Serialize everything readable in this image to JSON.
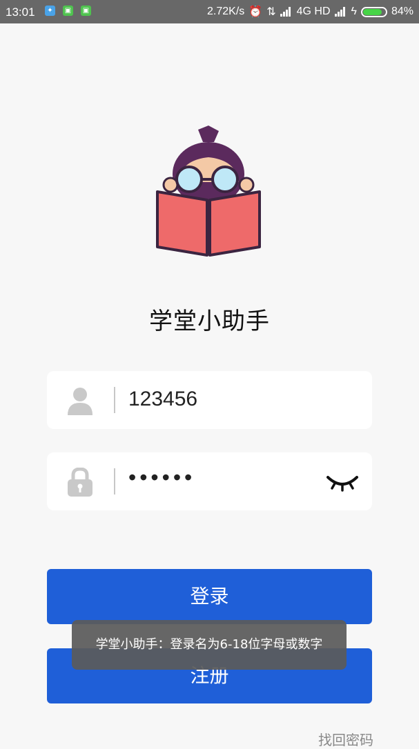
{
  "status_bar": {
    "time": "13:01",
    "network_speed": "2.72K/s",
    "network_type": "4G HD",
    "battery": "84%",
    "battery_level": 0.84,
    "battery_color": "#47d447"
  },
  "app": {
    "title": "学堂小助手",
    "logo_icon": "reading-student-logo"
  },
  "login_form": {
    "username_icon": "user-icon",
    "username_value": "123456",
    "password_icon": "lock-icon",
    "password_value": "••••••",
    "visibility_icon": "eye-closed-icon",
    "login_label": "登录",
    "register_label": "注册",
    "forgot_label": "找回密码"
  },
  "toast": {
    "message": "学堂小助手：登录名为6-18位字母或数字"
  },
  "colors": {
    "accent": "#1f5fd8",
    "background": "#f7f7f7",
    "status_bar": "#686868"
  }
}
